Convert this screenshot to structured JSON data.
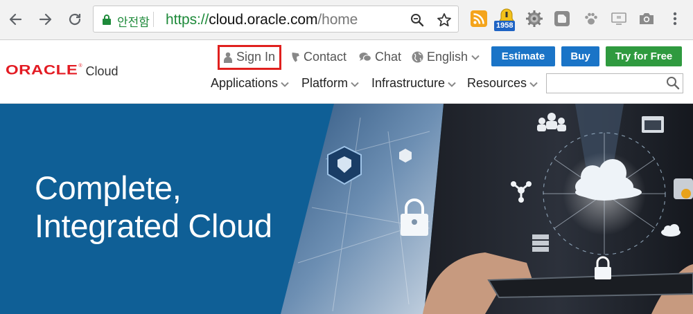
{
  "browser": {
    "secure_label": "안전함",
    "url_scheme": "https://",
    "url_host": "cloud.oracle.com",
    "url_path": "/home",
    "extension_badge": "1958",
    "icons": [
      "back-arrow-icon",
      "forward-arrow-icon",
      "reload-icon",
      "lock-icon",
      "zoom-icon",
      "star-icon",
      "rss-icon",
      "notification-extension-icon",
      "gear-extension-icon",
      "square-extension-icon",
      "paw-extension-icon",
      "screen-extension-icon",
      "camera-extension-icon",
      "more-menu-icon"
    ]
  },
  "header": {
    "logo_brand": "ORACLE",
    "logo_reg": "®",
    "logo_product": "Cloud",
    "utility": {
      "sign_in": "Sign In",
      "contact": "Contact",
      "chat": "Chat",
      "language": "English"
    },
    "buttons": {
      "estimate": "Estimate",
      "buy": "Buy",
      "try_free": "Try for Free"
    },
    "menu": [
      "Applications",
      "Platform",
      "Infrastructure",
      "Resources"
    ],
    "search": {
      "placeholder": "",
      "value": ""
    },
    "colors": {
      "logo_red": "#e31b23",
      "button_blue": "#1a74c7",
      "button_green": "#2f9a3f",
      "highlight_red": "#e0201e"
    }
  },
  "hero": {
    "title_line1": "Complete,",
    "title_line2": "Integrated Cloud",
    "background_color": "#0f5f96"
  }
}
